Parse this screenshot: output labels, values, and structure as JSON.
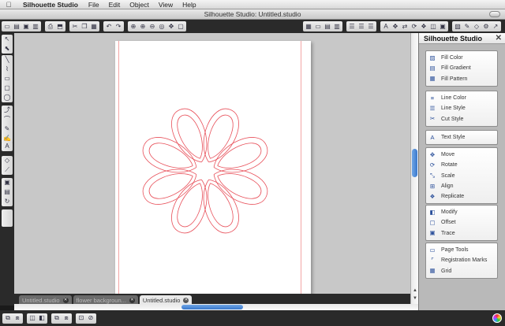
{
  "menubar": {
    "apple": "",
    "app_name": "Silhouette Studio",
    "items": [
      "File",
      "Edit",
      "Object",
      "View",
      "Help"
    ]
  },
  "window": {
    "title": "Silhouette Studio: Untitled.studio"
  },
  "panel": {
    "title": "Silhouette Studio",
    "close": "✕",
    "groups": [
      {
        "items": [
          {
            "label": "Fill Color",
            "icon": "fill-color-icon"
          },
          {
            "label": "Fill Gradient",
            "icon": "fill-gradient-icon"
          },
          {
            "label": "Fill Pattern",
            "icon": "fill-pattern-icon"
          }
        ]
      },
      {
        "items": [
          {
            "label": "Line Color",
            "icon": "line-color-icon"
          },
          {
            "label": "Line Style",
            "icon": "line-style-icon"
          },
          {
            "label": "Cut Style",
            "icon": "cut-style-icon"
          }
        ]
      },
      {
        "items": [
          {
            "label": "Text Style",
            "icon": "text-style-icon"
          }
        ]
      },
      {
        "items": [
          {
            "label": "Move",
            "icon": "move-icon"
          },
          {
            "label": "Rotate",
            "icon": "rotate-icon"
          },
          {
            "label": "Scale",
            "icon": "scale-icon"
          },
          {
            "label": "Align",
            "icon": "align-icon"
          },
          {
            "label": "Replicate",
            "icon": "replicate-icon"
          }
        ]
      },
      {
        "items": [
          {
            "label": "Modify",
            "icon": "modify-icon"
          },
          {
            "label": "Offset",
            "icon": "offset-icon"
          },
          {
            "label": "Trace",
            "icon": "trace-icon"
          }
        ]
      },
      {
        "items": [
          {
            "label": "Page Tools",
            "icon": "page-tools-icon"
          },
          {
            "label": "Registration Marks",
            "icon": "registration-marks-icon"
          },
          {
            "label": "Grid",
            "icon": "grid-icon"
          }
        ]
      }
    ]
  },
  "tabs": [
    {
      "label": "Untitled.studio",
      "active": false
    },
    {
      "label": "flower backgroun...",
      "active": false
    },
    {
      "label": "Untitled.studio",
      "active": true
    }
  ],
  "colors": {
    "cut_line": "#e8505a",
    "margin_line": "#f3a5a5",
    "scroll_thumb": "#3a78cc"
  }
}
